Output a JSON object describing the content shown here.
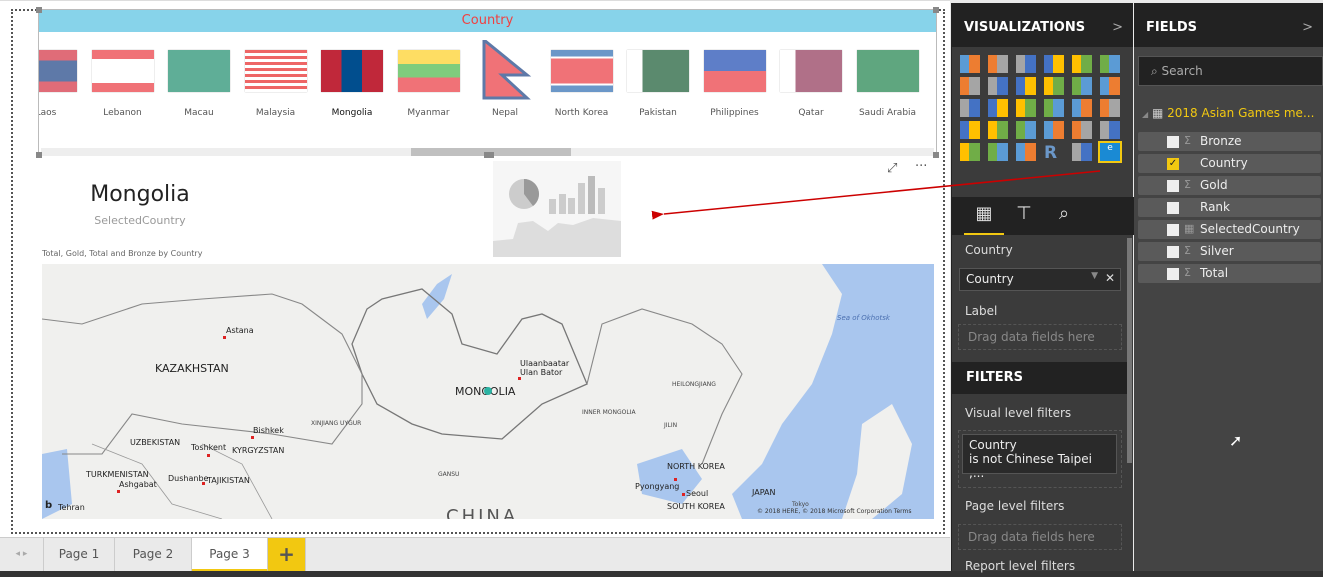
{
  "slicer": {
    "title": "Country",
    "items": [
      {
        "name": "Laos",
        "selected": false
      },
      {
        "name": "Lebanon",
        "selected": false
      },
      {
        "name": "Macau",
        "selected": false
      },
      {
        "name": "Malaysia",
        "selected": false
      },
      {
        "name": "Mongolia",
        "selected": true
      },
      {
        "name": "Myanmar",
        "selected": false
      },
      {
        "name": "Nepal",
        "selected": false
      },
      {
        "name": "North Korea",
        "selected": false
      },
      {
        "name": "Pakistan",
        "selected": false
      },
      {
        "name": "Philippines",
        "selected": false
      },
      {
        "name": "Qatar",
        "selected": false
      },
      {
        "name": "Saudi Arabia",
        "selected": false
      }
    ]
  },
  "card": {
    "value": "Mongolia",
    "label": "SelectedCountry"
  },
  "map": {
    "title": "Total, Gold, Total and Bronze by Country",
    "labels": {
      "astana": "Astana",
      "kazakhstan": "KAZAKHSTAN",
      "ulaanbaatar": "Ulaanbaatar",
      "ulanbator": "Ulan Bator",
      "mongolia": "MONGOLIA",
      "heilongjiang": "HEILONGJIANG",
      "innermongolia": "INNER MONGOLIA",
      "xinjiang": "XINJIANG UYGUR",
      "jilin": "JILIN",
      "bishkek": "Bishkek",
      "uzbekistan": "UZBEKISTAN",
      "toshkent": "Toshkent",
      "kyrgyzstan": "KYRGYZSTAN",
      "turkmenistan": "TURKMENISTAN",
      "ashgabat": "Ashgabat",
      "dushanbe": "Dushanbe",
      "tajikistan": "TAJIKISTAN",
      "gansu": "GANSU",
      "northkorea": "NORTH KOREA",
      "pyongyang": "Pyongyang",
      "seoul": "Seoul",
      "southkorea": "SOUTH KOREA",
      "japan": "JAPAN",
      "okhotsk": "Sea of Okhotsk",
      "china": "CHINA",
      "tehran": "Tehran",
      "tokyo": "Tokyo"
    },
    "copyright": "© 2018 HERE, © 2018 Microsoft Corporation Terms"
  },
  "tabs": [
    {
      "label": "Page 1"
    },
    {
      "label": "Page 2"
    },
    {
      "label": "Page 3",
      "active": true
    }
  ],
  "add_page": "+",
  "visualizations": {
    "title": "VISUALIZATIONS",
    "fields_label": "Country",
    "field_value": "Country",
    "label_label": "Label",
    "drag_hint": "Drag data fields here"
  },
  "filters": {
    "title": "FILTERS",
    "visual": "Visual level filters",
    "filter_field": "Country",
    "filter_desc": "is not Chinese Taipei ,...",
    "page": "Page level filters",
    "page_hint": "Drag data fields here",
    "report": "Report level filters"
  },
  "fields": {
    "title": "FIELDS",
    "search_placeholder": "Search",
    "table": "2018 Asian Games me...",
    "items": [
      {
        "name": "Bronze",
        "checked": false,
        "icon": "sigma"
      },
      {
        "name": "Country",
        "checked": true,
        "icon": ""
      },
      {
        "name": "Gold",
        "checked": false,
        "icon": "sigma"
      },
      {
        "name": "Rank",
        "checked": false,
        "icon": ""
      },
      {
        "name": "SelectedCountry",
        "checked": false,
        "icon": "calculator"
      },
      {
        "name": "Silver",
        "checked": false,
        "icon": "sigma"
      },
      {
        "name": "Total",
        "checked": false,
        "icon": "sigma"
      }
    ]
  },
  "colors": {
    "accent": "#f2c811",
    "slicer_header": "#87d3ea",
    "arrow": "#cc0000"
  }
}
